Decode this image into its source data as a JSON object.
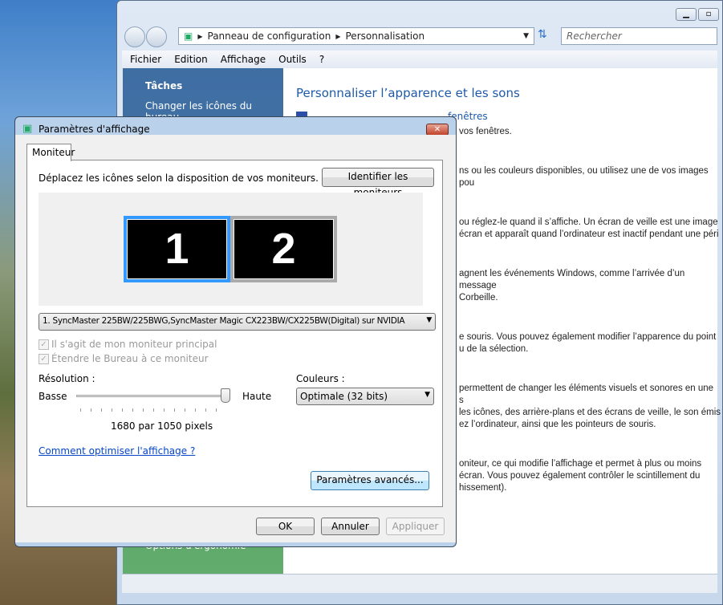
{
  "window": {
    "breadcrumb": [
      "Panneau de configuration",
      "Personnalisation"
    ],
    "search_placeholder": "Rechercher",
    "menu": [
      "Fichier",
      "Edition",
      "Affichage",
      "Outils",
      "?"
    ]
  },
  "sidebar": {
    "heading": "Tâches",
    "items": [
      "Changer les icônes du bureau"
    ],
    "bottom_item": "Options d'ergonomie"
  },
  "main": {
    "title": "Personnaliser l’apparence et les sons",
    "link_fragment": "fenêtres",
    "fragments": [
      "vos fenêtres.",
      "ns ou les couleurs disponibles, ou utilisez une de vos images pou",
      "ou réglez-le quand il s’affiche. Un écran de veille est une image",
      "écran et apparaît quand l’ordinateur est inactif pendant une péri",
      "agnent les événements Windows, comme l’arrivée d’un message",
      "Corbeille.",
      "e souris. Vous pouvez également modifier l’apparence du point",
      "u de la sélection.",
      "permettent de changer les éléments visuels et sonores en une s",
      "les icônes, des arrière-plans et des écrans de veille, le son émis",
      "ez l’ordinateur, ainsi que les pointeurs de souris.",
      "oniteur, ce qui modifie l’affichage et permet à plus ou moins",
      "écran. Vous pouvez également contrôler le scintillement du",
      "hissement)."
    ]
  },
  "dialog": {
    "title": "Paramètres d'affichage",
    "close": "✕",
    "tab": "Moniteur",
    "instruction": "Déplacez les icônes selon la disposition de vos moniteurs.",
    "identify_button": "Identifier les moniteurs",
    "monitors": [
      "1",
      "2"
    ],
    "monitor_select": "1. SyncMaster 225BW/225BWG,SyncMaster Magic CX223BW/CX225BW(Digital) sur NVIDIA",
    "checkbox_primary": "Il s'agit de mon moniteur principal",
    "checkbox_extend": "Étendre le Bureau à ce moniteur",
    "resolution_label": "Résolution :",
    "low": "Basse",
    "high": "Haute",
    "resolution_value": "1680 par 1050 pixels",
    "resolution_slider_fraction": 1.0,
    "colors_label": "Couleurs :",
    "colors_value": "Optimale (32 bits)",
    "help_link": "Comment optimiser l'affichage ?",
    "advanced_button": "Paramètres avancés...",
    "ok": "OK",
    "cancel": "Annuler",
    "apply": "Appliquer"
  }
}
